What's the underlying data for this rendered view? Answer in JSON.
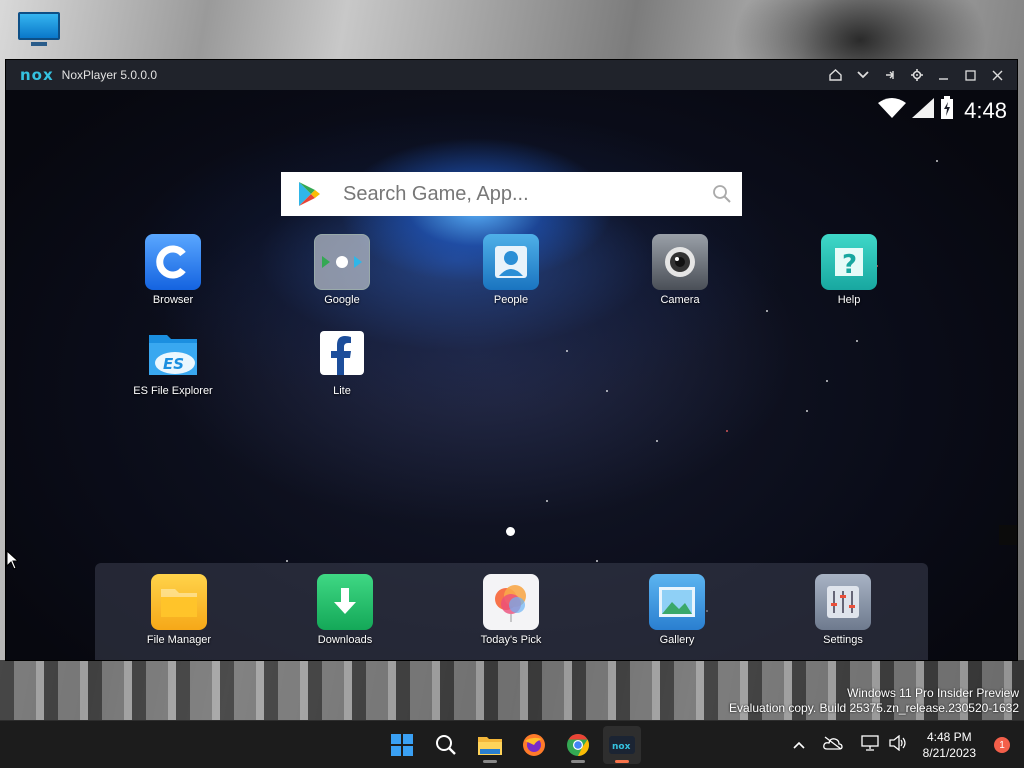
{
  "window": {
    "logo": "nox",
    "title": "NoxPlayer 5.0.0.0",
    "controls": [
      "home-icon",
      "chevron-down-icon",
      "pin-icon",
      "gear-icon",
      "minimize-icon",
      "maximize-icon",
      "close-icon"
    ]
  },
  "android": {
    "status": {
      "time": "4:48",
      "icons": [
        "wifi-icon",
        "signal-icon",
        "battery-charging-icon"
      ]
    },
    "search": {
      "placeholder": "Search Game, App..."
    },
    "apps": [
      {
        "label": "Browser",
        "icon": "browser-icon"
      },
      {
        "label": "Google",
        "icon": "google-folder-icon"
      },
      {
        "label": "People",
        "icon": "people-icon"
      },
      {
        "label": "Camera",
        "icon": "camera-icon"
      },
      {
        "label": "Help",
        "icon": "help-icon"
      },
      {
        "label": "ES File Explorer",
        "icon": "es-file-explorer-icon"
      },
      {
        "label": "Lite",
        "icon": "facebook-lite-icon"
      }
    ],
    "dock": [
      {
        "label": "File Manager",
        "icon": "folder-icon"
      },
      {
        "label": "Downloads",
        "icon": "download-icon"
      },
      {
        "label": "Today's Pick",
        "icon": "balloons-icon"
      },
      {
        "label": "Gallery",
        "icon": "gallery-icon"
      },
      {
        "label": "Settings",
        "icon": "settings-sliders-icon"
      }
    ],
    "page_indicator": {
      "pages": 1,
      "current": 1
    }
  },
  "watermark": {
    "line1": "Windows 11 Pro Insider Preview",
    "line2": "Evaluation copy. Build 25375.zn_release.230520-1632"
  },
  "taskbar": {
    "apps": [
      "windows-start-icon",
      "search-icon",
      "file-explorer-icon",
      "firefox-icon",
      "chrome-icon",
      "nox-icon"
    ],
    "clock": {
      "time": "4:48 PM",
      "date": "8/21/2023"
    },
    "notification_count": "1",
    "colors": {
      "accent": "#f7734a",
      "nox": "#35c2e0"
    }
  }
}
